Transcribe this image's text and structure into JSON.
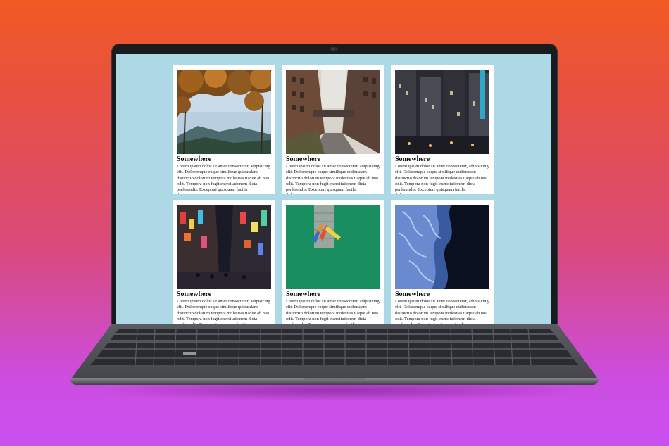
{
  "cards": [
    {
      "title": "Somewhere",
      "text": "Lorem ipsum dolor sit amet consectetur, adipisicing elit. Doloremque eaque similique quibusdam distinctio dolorum tempora molestias itaque ab nisi odit. Tempora non fugit exercitationem dicta perferendis. Excepturi quisquam facilis doloremque.",
      "photo": "autumn-trees-mountain-photo"
    },
    {
      "title": "Somewhere",
      "text": "Lorem ipsum dolor sit amet consectetur, adipisicing elit. Doloremque eaque similique quibusdam distinctio dolorum tempora molestias itaque ab nisi odit. Tempora non fugit exercitationem dicta perferendis. Excepturi quisquam facilis doloremque.",
      "photo": "city-street-bridge-photo"
    },
    {
      "title": "Somewhere",
      "text": "Lorem ipsum dolor sit amet consectetur, adipisicing elit. Doloremque eaque similique quibusdam distinctio dolorum tempora molestias itaque ab nisi odit. Tempora non fugit exercitationem dicta perferendis. Excepturi quisquam facilis doloremque.",
      "photo": "night-city-skyscrapers-photo"
    },
    {
      "title": "Somewhere",
      "text": "Lorem ipsum dolor sit amet consectetur, adipisicing elit. Doloremque eaque similique quibusdam distinctio dolorum tempora molestias itaque ab nisi odit. Tempora non fugit exercitationem dicta perferendis. Excepturi quisquam facilis doloremque.",
      "photo": "neon-street-night-photo"
    },
    {
      "title": "Somewhere",
      "text": "Lorem ipsum dolor sit amet consectetur, adipisicing elit. Doloremque eaque similique quibusdam distinctio dolorum tempora molestias itaque ab nisi odit. Tempora non fugit exercitationem dicta perferendis. Excepturi quisquam facilis doloremque.",
      "photo": "kayaks-green-water-photo"
    },
    {
      "title": "Somewhere",
      "text": "Lorem ipsum dolor sit amet consectetur, adipisicing elit. Doloremque eaque similique quibusdam distinctio dolorum tempora molestias itaque ab nisi odit. Tempora non fugit exercitationem dicta perferendis. Excepturi quisquam facilis doloremque.",
      "photo": "ocean-waves-aerial-photo"
    }
  ],
  "colors": {
    "page_background": "#add8e6",
    "card_background": "#ffffff",
    "gradient_top": "#f15a24",
    "gradient_bottom": "#c94ff0"
  }
}
